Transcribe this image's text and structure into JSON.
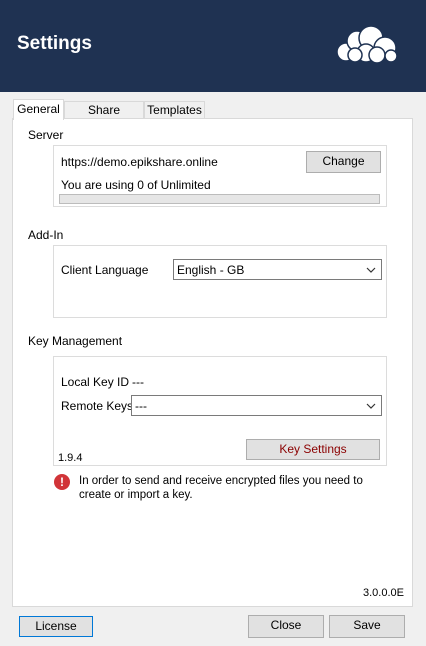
{
  "header": {
    "title": "Settings",
    "logo_icon": "owncloud-cloud-logo-icon",
    "background": "#1f3252"
  },
  "tabs": [
    {
      "label": "General",
      "active": true
    },
    {
      "label": "Share Settings",
      "active": false
    },
    {
      "label": "Templates",
      "active": false
    }
  ],
  "server": {
    "section_label": "Server",
    "url": "https://demo.epikshare.online",
    "change_button": "Change",
    "usage_text": "You are using 0 of Unlimited",
    "usage_fraction": 0
  },
  "addin": {
    "section_label": "Add-In",
    "language_label": "Client Language",
    "language_value": "English - GB"
  },
  "key_management": {
    "section_label": "Key Management",
    "local_key_label": "Local Key ID",
    "local_key_value": "---",
    "remote_keys_label": "Remote Keys",
    "remote_keys_value": "---",
    "version": "1.9.4",
    "key_settings_button": "Key Settings",
    "warning_icon": "error-icon",
    "warning_text": "In order to send and receive encrypted files you need to create or import a key."
  },
  "app_version": "3.0.0.0E",
  "footer": {
    "license_button": "License",
    "close_button": "Close",
    "save_button": "Save"
  }
}
